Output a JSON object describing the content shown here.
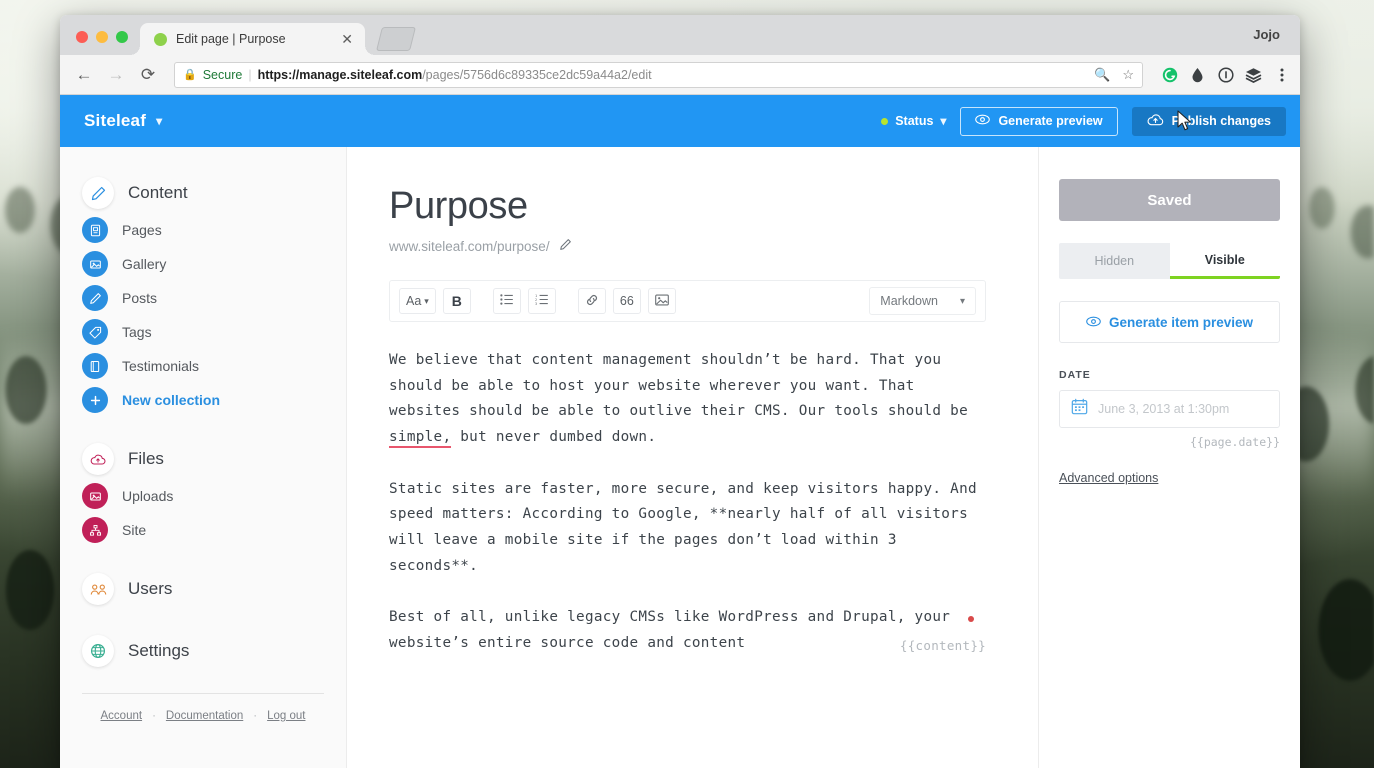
{
  "browser": {
    "profile_name": "Jojo",
    "tab": {
      "title": "Edit page | Purpose",
      "close_label": "✕",
      "favicon": "green-circle-favicon"
    },
    "nav": {
      "back": "←",
      "forward": "→",
      "reload": "⟳"
    },
    "omnibox": {
      "lock_icon": "lock-icon",
      "secure_label": "Secure",
      "url_scheme": "https://",
      "url_host": "manage.siteleaf.com",
      "url_path": "/pages/5756d6c89335ce2dc59a44a2/edit",
      "zoom_icon": "search-icon",
      "bookmark_icon": "star-icon"
    },
    "extensions": [
      "grammarly-icon",
      "droplet-icon",
      "info-circle-icon",
      "layers-icon",
      "kebab-menu-icon"
    ]
  },
  "appbar": {
    "brand": "Siteleaf",
    "brand_chevron": "chevron-down-icon",
    "status_label": "Status",
    "status_chevron": "chevron-down-icon",
    "status_color": "#b8e32e",
    "generate_preview_label": "Generate preview",
    "publish_label": "Publish changes",
    "accent_color": "#2196f3",
    "publish_bg": "#1878c4"
  },
  "sidebar": {
    "groups": [
      {
        "header": {
          "label": "Content",
          "icon": "pencil-icon",
          "icon_style": "white"
        },
        "items": [
          {
            "label": "Pages",
            "icon": "page-icon",
            "icon_style": "blue",
            "accent": false
          },
          {
            "label": "Gallery",
            "icon": "image-icon",
            "icon_style": "blue",
            "accent": false
          },
          {
            "label": "Posts",
            "icon": "pencil-icon",
            "icon_style": "blue",
            "accent": false
          },
          {
            "label": "Tags",
            "icon": "tag-icon",
            "icon_style": "blue",
            "accent": false
          },
          {
            "label": "Testimonials",
            "icon": "book-icon",
            "icon_style": "blue",
            "accent": false
          },
          {
            "label": "New collection",
            "icon": "plus-icon",
            "icon_style": "blue",
            "accent": true
          }
        ]
      },
      {
        "header": {
          "label": "Files",
          "icon": "cloud-icon",
          "icon_style": "white"
        },
        "items": [
          {
            "label": "Uploads",
            "icon": "image-icon",
            "icon_style": "crimson",
            "accent": false
          },
          {
            "label": "Site",
            "icon": "sitemap-icon",
            "icon_style": "crimson",
            "accent": false
          }
        ]
      },
      {
        "header": {
          "label": "Users",
          "icon": "users-icon",
          "icon_style": "white"
        },
        "items": []
      },
      {
        "header": {
          "label": "Settings",
          "icon": "globe-icon",
          "icon_style": "white"
        },
        "items": []
      }
    ],
    "footer": {
      "account": "Account",
      "documentation": "Documentation",
      "logout": "Log out",
      "separator": "·"
    }
  },
  "main": {
    "title": "Purpose",
    "permalink": "www.siteleaf.com/purpose/",
    "permalink_edit_icon": "pencil-icon",
    "toolbar": {
      "font_label": "Aa",
      "font_chevron": "chevron-down-icon",
      "bold_label": "B",
      "bullet_list_icon": "bullet-list-icon",
      "numbered_list_icon": "numbered-list-icon",
      "link_icon": "link-icon",
      "quote_label": "66",
      "image_icon": "image-icon",
      "format_select": "Markdown",
      "format_chevron": "chevron-down-icon"
    },
    "editor": {
      "paragraphs": [
        "We believe that content management shouldn’t be hard. That you should be able to host your website wherever you want. That websites should be able to outlive their CMS. Our tools should be simple, but never dumbed down.",
        "Static sites are faster, more secure, and keep visitors happy. And speed matters: According to Google, **nearly half of all visitors will leave a mobile site if the pages don’t load within 3 seconds**.",
        "Best of all, unlike legacy CMSs like WordPress and Drupal, your website’s entire source code and content"
      ],
      "p1_before": "We believe that content management shouldn’t be hard. That you should be able to host your website wherever you want. That websites should be able to outlive their CMS. Our tools should be ",
      "p1_misspelled": "simple,",
      "p1_after": " but never dumbed down.",
      "misspell_color": "#e8566d",
      "content_token": "{{content}}"
    }
  },
  "rightpanel": {
    "save_status": "Saved",
    "visibility": {
      "hidden": "Hidden",
      "visible": "Visible",
      "active": "Visible",
      "active_underline_color": "#7ed321"
    },
    "generate_item_preview": "Generate item preview",
    "generate_item_preview_icon": "eye-icon",
    "date_label": "DATE",
    "date_placeholder": "June 3, 2013 at 1:30pm",
    "date_icon": "calendar-icon",
    "date_token": "{{page.date}}",
    "advanced_options": "Advanced options"
  }
}
